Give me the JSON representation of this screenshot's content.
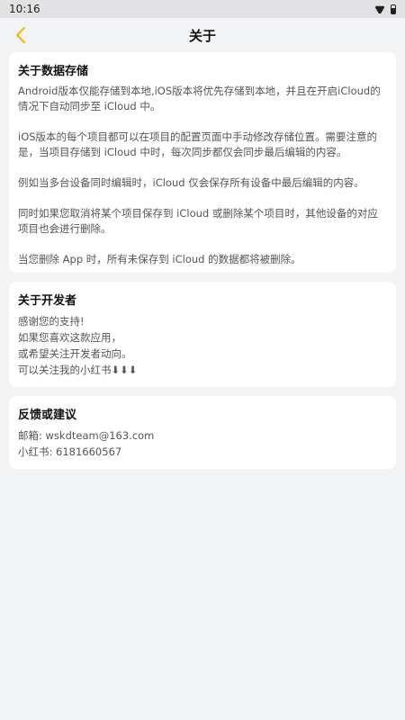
{
  "status_bar": {
    "time": "10:16",
    "icons": [
      "wifi-icon",
      "battery-icon"
    ]
  },
  "header": {
    "title": "关于",
    "back_icon": "chevron-left-icon",
    "accent_color": "#f5b800"
  },
  "data_storage": {
    "title": "关于数据存储",
    "paragraphs": [
      "Android版本仅能存储到本地,iOS版本将优先存储到本地，并且在开启iCloud的情况下自动同步至 iCloud 中。",
      "iOS版本的每个项目都可以在项目的配置页面中手动修改存储位置。需要注意的是，当项目存储到 iCloud 中时，每次同步都仅会同步最后编辑的内容。",
      "例如当多台设备同时编辑时，iCloud 仅会保存所有设备中最后编辑的内容。",
      "同时如果您取消将某个项目保存到 iCloud 或删除某个项目时，其他设备的对应项目也会进行删除。",
      "当您删除 App 时，所有未保存到 iCloud 的数据都将被删除。"
    ]
  },
  "developer": {
    "title": "关于开发者",
    "lines": [
      "感谢您的支持!",
      "如果您喜欢这款应用，",
      "或希望关注开发者动向。",
      "可以关注我的小红书⬇⬇⬇"
    ]
  },
  "feedback": {
    "title": "反馈或建议",
    "email": "邮箱: wskdteam@163.com",
    "xiaohongshu": "小红书: 6181660567"
  }
}
